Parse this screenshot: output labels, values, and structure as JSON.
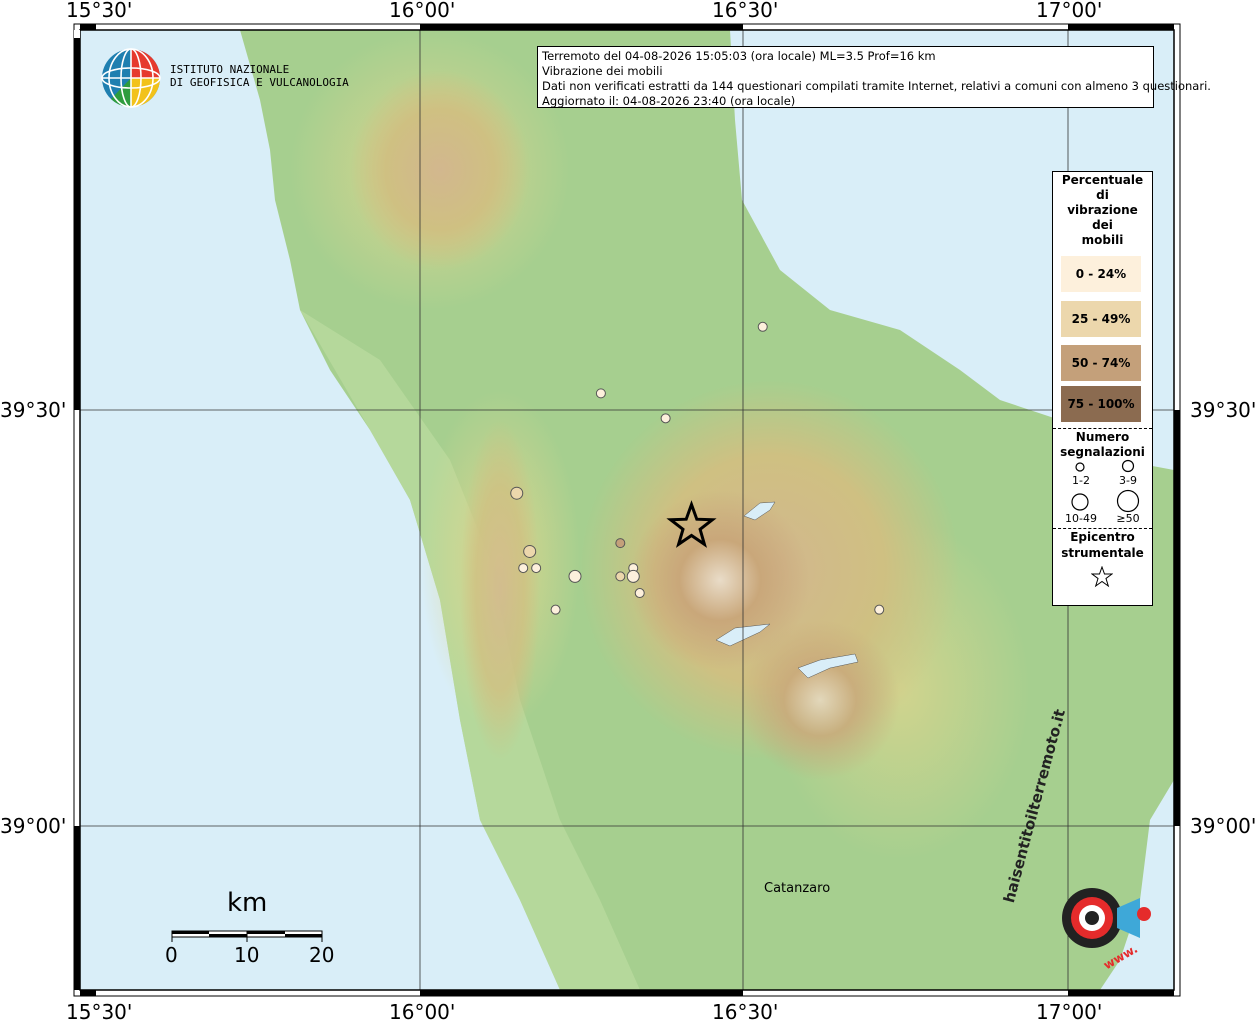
{
  "info_box": {
    "line1": "Terremoto del 04-08-2026 15:05:03 (ora locale) ML=3.5 Prof=16 km",
    "line2": "Vibrazione dei mobili",
    "line3": "Dati non verificati estratti da 144 questionari compilati tramite Internet, relativi a comuni con almeno 3 questionari.",
    "line4": "Aggiornato il: 04-08-2026 23:40 (ora locale)"
  },
  "logo": {
    "line1": "ISTITUTO NAZIONALE",
    "line2": "DI GEOFISICA E VULCANOLOGIA"
  },
  "axes": {
    "lon_labels": [
      "15°30'",
      "16°00'",
      "16°30'",
      "17°00'"
    ],
    "lat_labels": [
      "39°30'",
      "39°00'"
    ]
  },
  "legend": {
    "title_lines": [
      "Percentuale",
      "di",
      "vibrazione",
      "dei",
      "mobili"
    ],
    "classes": [
      {
        "label": "0 - 24%",
        "color": "#fdf0dc"
      },
      {
        "label": "25 - 49%",
        "color": "#ecd7ac"
      },
      {
        "label": "50 - 74%",
        "color": "#c4a07a"
      },
      {
        "label": "75 - 100%",
        "color": "#8b6b50"
      }
    ],
    "count_title_lines": [
      "Numero",
      "segnalazioni"
    ],
    "count_labels": [
      "1-2",
      "3-9",
      "10-49",
      "≥50"
    ],
    "epicenter_title_lines": [
      "Epicentro",
      "strumentale"
    ]
  },
  "scale": {
    "unit": "km",
    "labels": [
      "0",
      "10",
      "20"
    ]
  },
  "place": "Catanzaro",
  "brand": {
    "text": "haisentitoilterremoto.it",
    "text2": "www."
  },
  "map_data": {
    "epicenter": {
      "lon": 16.42,
      "lat": 39.36
    },
    "reports": [
      {
        "lon": 16.53,
        "lat": 39.6,
        "pct_class": 0,
        "count_class": 0
      },
      {
        "lon": 16.28,
        "lat": 39.52,
        "pct_class": 0,
        "count_class": 0
      },
      {
        "lon": 16.38,
        "lat": 39.49,
        "pct_class": 0,
        "count_class": 0
      },
      {
        "lon": 16.15,
        "lat": 39.4,
        "pct_class": 1,
        "count_class": 1
      },
      {
        "lon": 16.17,
        "lat": 39.33,
        "pct_class": 1,
        "count_class": 1
      },
      {
        "lon": 16.31,
        "lat": 39.34,
        "pct_class": 2,
        "count_class": 0
      },
      {
        "lon": 16.16,
        "lat": 39.31,
        "pct_class": 0,
        "count_class": 0
      },
      {
        "lon": 16.18,
        "lat": 39.31,
        "pct_class": 0,
        "count_class": 0
      },
      {
        "lon": 16.24,
        "lat": 39.3,
        "pct_class": 0,
        "count_class": 1
      },
      {
        "lon": 16.31,
        "lat": 39.3,
        "pct_class": 1,
        "count_class": 0
      },
      {
        "lon": 16.33,
        "lat": 39.31,
        "pct_class": 0,
        "count_class": 0
      },
      {
        "lon": 16.33,
        "lat": 39.3,
        "pct_class": 0,
        "count_class": 1
      },
      {
        "lon": 16.34,
        "lat": 39.28,
        "pct_class": 0,
        "count_class": 0
      },
      {
        "lon": 16.21,
        "lat": 39.26,
        "pct_class": 0,
        "count_class": 0
      },
      {
        "lon": 16.71,
        "lat": 39.26,
        "pct_class": 0,
        "count_class": 0
      }
    ]
  }
}
